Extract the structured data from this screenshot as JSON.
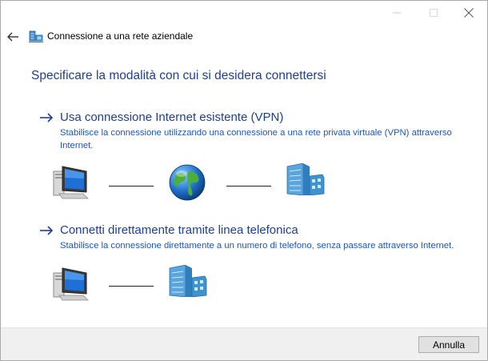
{
  "window": {
    "title": "Connessione a una rete aziendale",
    "controls": {
      "minimize": "minimize-icon",
      "maximize": "maximize-icon",
      "close": "close-icon"
    }
  },
  "main": {
    "heading": "Specificare la modalità con cui si desidera connettersi",
    "options": [
      {
        "title": "Usa connessione Internet esistente (VPN)",
        "description": "Stabilisce la connessione utilizzando una connessione a una rete privata virtuale (VPN) attraverso Internet.",
        "diagram": [
          "computer-icon",
          "globe-icon",
          "office-building-icon"
        ]
      },
      {
        "title": "Connetti direttamente tramite linea telefonica",
        "description": "Stabilisce la connessione direttamente a un numero di telefono, senza passare attraverso Internet.",
        "diagram": [
          "computer-icon",
          "office-building-icon"
        ]
      }
    ]
  },
  "footer": {
    "cancel_label": "Annulla"
  },
  "colors": {
    "heading": "#1f3f8f",
    "link_text": "#1a56c4",
    "footer_bg": "#f0f0f0"
  }
}
